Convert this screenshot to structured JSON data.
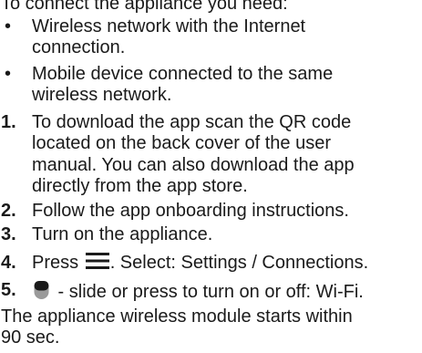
{
  "intro": "To connect the appliance you need:",
  "bullets": [
    {
      "mark": "•",
      "lines": [
        "Wireless network with the Internet",
        "connection."
      ]
    },
    {
      "mark": "•",
      "lines": [
        "Mobile device connected to the same",
        "wireless network."
      ]
    }
  ],
  "steps": [
    {
      "num": "1.",
      "lines": [
        "To download the app scan the QR code",
        "located on the back cover of the user",
        "manual. You can also download the app",
        "directly from the app store."
      ]
    },
    {
      "num": "2.",
      "text": "Follow the app onboarding instructions."
    },
    {
      "num": "3.",
      "text": "Turn on the appliance."
    },
    {
      "num": "4.",
      "before_icon": "Press",
      "icon": "menu-icon",
      "after_icon": ". Select: Settings / Connections."
    },
    {
      "num": "5.",
      "icon": "toggle-icon",
      "after_icon": " - slide or press to turn on or off: Wi-Fi."
    }
  ],
  "tail_lines": [
    "The appliance wireless module starts within",
    "90 sec."
  ],
  "colors": {
    "text": "#1a1a1a",
    "icon_dark": "#1a1a1a",
    "icon_light": "#9a9a9a"
  }
}
